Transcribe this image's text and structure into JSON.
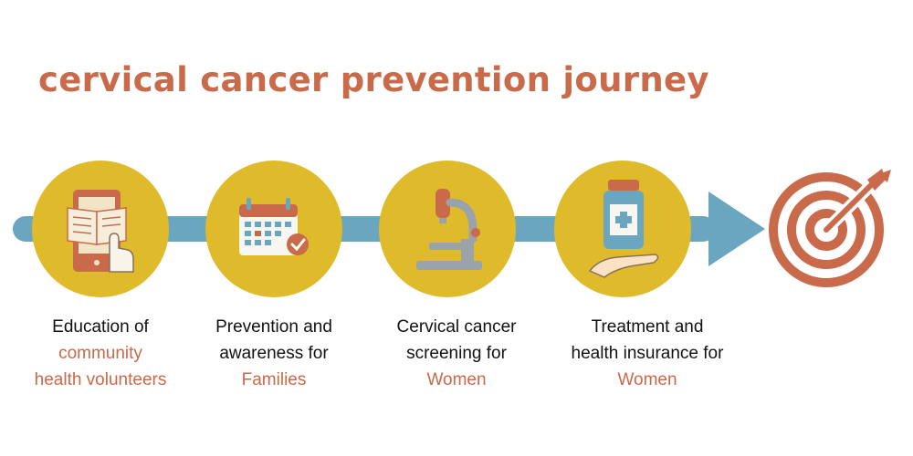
{
  "title": "cervical cancer prevention journey",
  "colors": {
    "accent": "#c96a4a",
    "circle": "#dfbb2c",
    "arrow": "#6aa6c0",
    "text": "#111111"
  },
  "steps": [
    {
      "icon": "book-tablet-icon",
      "line1": "Education of",
      "line2": "community",
      "line3": "health volunteers"
    },
    {
      "icon": "calendar-check-icon",
      "line1": "Prevention and",
      "line2": "awareness for",
      "line3": "Families"
    },
    {
      "icon": "microscope-icon",
      "line1": "Cervical cancer",
      "line2": "screening for",
      "line3": "Women"
    },
    {
      "icon": "medicine-hand-icon",
      "line1": "Treatment and",
      "line2": "health insurance for",
      "line3": "Women"
    }
  ],
  "goal_icon": "target-icon"
}
